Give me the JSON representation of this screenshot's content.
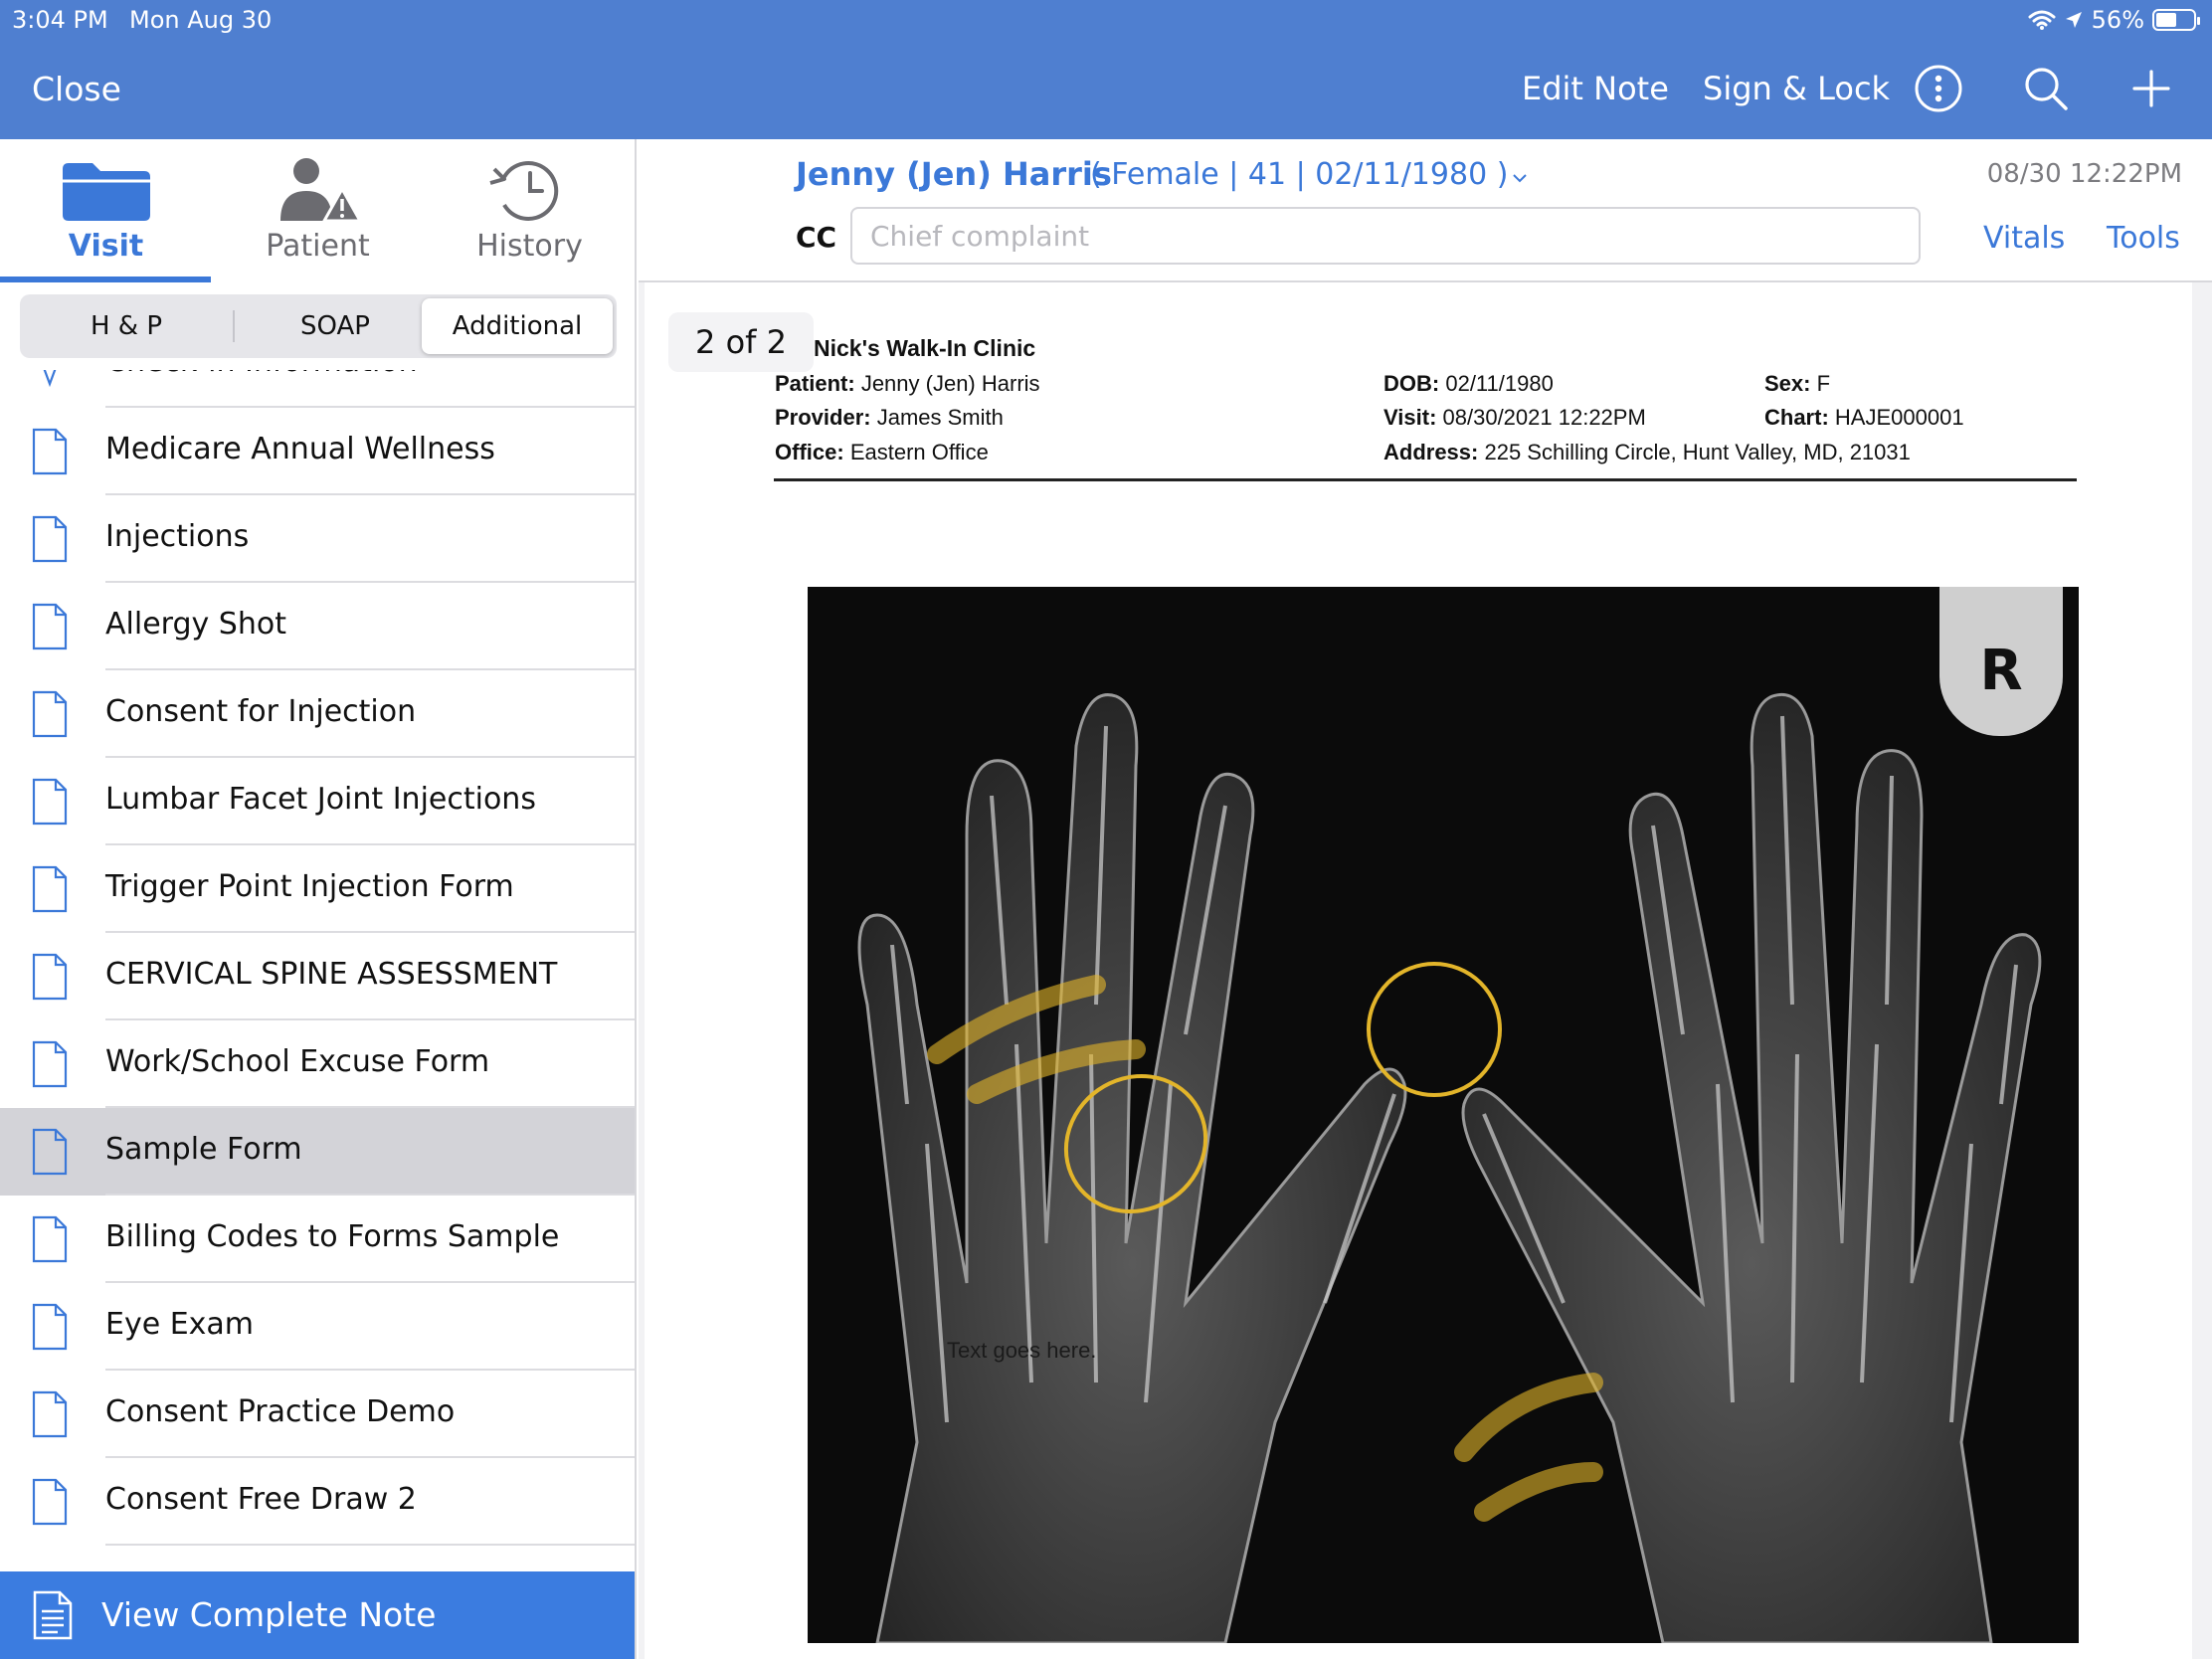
{
  "status": {
    "time": "3:04 PM",
    "date": "Mon Aug 30",
    "battery": "56%",
    "battery_level": 0.56
  },
  "nav": {
    "close": "Close",
    "edit_note": "Edit Note",
    "sign_lock": "Sign & Lock",
    "icons": [
      "more-icon",
      "search-icon",
      "add-icon"
    ]
  },
  "tabs": [
    {
      "label": "Visit",
      "icon": "folder-icon",
      "active": true
    },
    {
      "label": "Patient",
      "icon": "patient-alert-icon",
      "active": false
    },
    {
      "label": "History",
      "icon": "history-clock-icon",
      "active": false
    }
  ],
  "segments": [
    {
      "label": "H & P"
    },
    {
      "label": "SOAP"
    },
    {
      "label": "Additional"
    }
  ],
  "forms": [
    {
      "label": "Check-in Information"
    },
    {
      "label": "Medicare Annual Wellness"
    },
    {
      "label": "Injections"
    },
    {
      "label": "Allergy Shot"
    },
    {
      "label": "Consent for Injection"
    },
    {
      "label": "Lumbar Facet Joint Injections"
    },
    {
      "label": "Trigger Point Injection Form"
    },
    {
      "label": "CERVICAL SPINE ASSESSMENT"
    },
    {
      "label": "Work/School Excuse Form"
    },
    {
      "label": "Sample Form"
    },
    {
      "label": "Billing Codes to Forms Sample"
    },
    {
      "label": "Eye Exam"
    },
    {
      "label": "Consent Practice Demo"
    },
    {
      "label": "Consent Free Draw 2"
    }
  ],
  "view_complete_note": "View Complete Note",
  "patient": {
    "name": "Jenny (Jen) Harris",
    "meta": "( Female | 41 | 02/11/1980 )",
    "visit_datetime": "08/30 12:22PM"
  },
  "cc": {
    "label": "CC",
    "placeholder": "Chief complaint",
    "value": ""
  },
  "links": {
    "vitals": "Vitals",
    "tools": "Tools"
  },
  "document": {
    "page_indicator": "2 of 2",
    "clinic": "Nick's Walk-In Clinic",
    "fields": {
      "patient_label": "Patient:",
      "patient": "Jenny (Jen) Harris",
      "provider_label": "Provider:",
      "provider": "James Smith",
      "office_label": "Office:",
      "office": "Eastern Office",
      "dob_label": "DOB:",
      "dob": "02/11/1980",
      "visit_label": "Visit:",
      "visit": "08/30/2021 12:22PM",
      "address_label": "Address:",
      "address": "225 Schilling Circle, Hunt Valley, MD, 21031",
      "sex_label": "Sex:",
      "sex": "F",
      "chart_label": "Chart:",
      "chart": "HAJE000001"
    },
    "image": {
      "caption": "Text goes here.",
      "marker": "R",
      "annotation_color": "#e3b52a"
    }
  },
  "colors": {
    "header": "#4f7fd0",
    "accent": "#3b78d8",
    "button": "#3b7ce0",
    "selected_row": "#d3d3d8"
  }
}
